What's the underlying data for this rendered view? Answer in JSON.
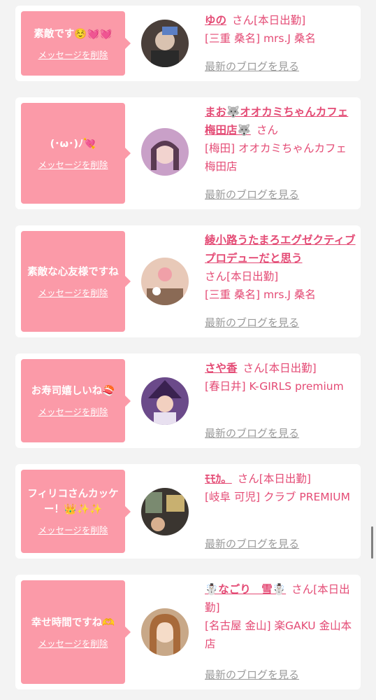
{
  "delete_label": "メッセージを削除",
  "blog_label": "最新のブログを見る",
  "honorific": "さん",
  "cards": [
    {
      "message": "素敵です☺️💓💓",
      "name": "ゆの",
      "after_name": "[本日出勤]",
      "shop": "[三重 桑名] mrs.J 桑名"
    },
    {
      "message": "(･ω･)ﾉ💘",
      "name": "まお🐺オオカミちゃんカフェ梅田店🐺",
      "after_name": "",
      "shop": "[梅田] オオカミちゃんカフェ梅田店"
    },
    {
      "message": "素敵な心友様ですね",
      "name": "綾小路うたまろエグゼクティブプロデューだと思う",
      "after_name": "[本日出勤]",
      "shop": "[三重 桑名] mrs.J 桑名"
    },
    {
      "message": "お寿司嬉しいね🍣",
      "name": "さや香",
      "after_name": "[本日出勤]",
      "shop": "[春日井] K-GIRLS premium"
    },
    {
      "message": "フィリコさんカッケー！👑✨✨",
      "name": "ﾓﾓｶ。",
      "after_name": "[本日出勤]",
      "shop": "[岐阜 可児] クラブ PREMIUM"
    },
    {
      "message": "幸せ時間ですね🫶",
      "name": "☃️なごり　雪☃️",
      "after_name": "[本日出勤]",
      "shop": "[名古屋 金山] 楽GAKU 金山本店"
    }
  ]
}
